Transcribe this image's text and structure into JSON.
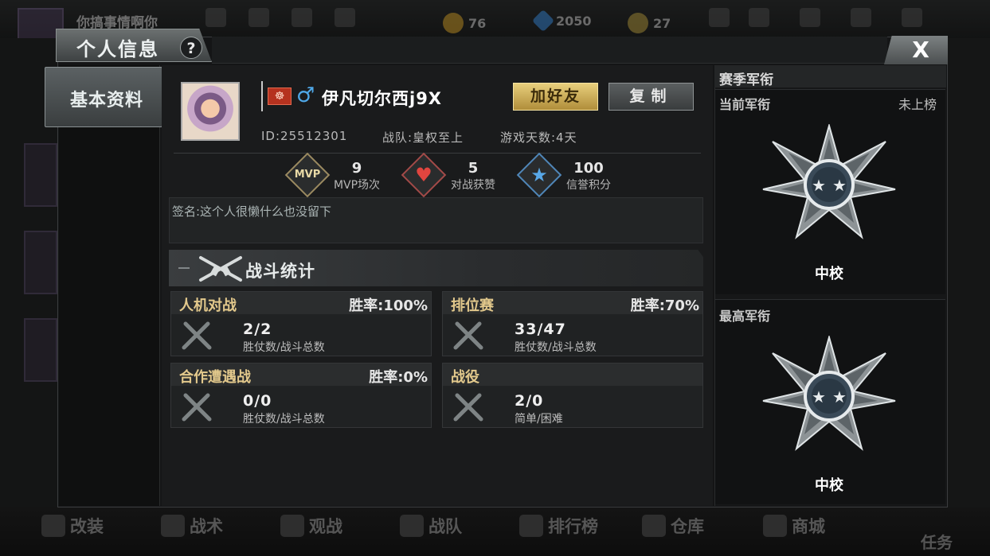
{
  "background": {
    "top_name": "你搞事情啊你",
    "currency": [
      {
        "icon": "gold-coin-icon",
        "value": "76",
        "color": "#c8962a"
      },
      {
        "icon": "diamond-icon",
        "value": "2050",
        "color": "#3a7fc8"
      },
      {
        "icon": "ticket-icon",
        "value": "27",
        "color": "#b8a040"
      }
    ],
    "bottom_nav": [
      "改装",
      "战术",
      "观战",
      "战队",
      "排行榜",
      "仓库",
      "商城"
    ],
    "task_label": "任务"
  },
  "dialog": {
    "title": "个人信息",
    "help_glyph": "?",
    "close_glyph": "X",
    "side_tab": "基本资料"
  },
  "profile": {
    "flag_glyph": "☸",
    "gender_glyph": "♂",
    "name": "伊凡切尔西j9X",
    "add_friend": "加好友",
    "copy": "复制",
    "id_text": "ID:25512301",
    "team_text": "战队:皇权至上",
    "days_text": "游戏天数:4天",
    "signature": "签名:这个人很懒什么也没留下"
  },
  "stats": [
    {
      "icon": "mvp-icon",
      "icon_glyph": "MVP",
      "value": "9",
      "label": "MVP场次"
    },
    {
      "icon": "heart-icon",
      "icon_glyph": "♥",
      "value": "5",
      "label": "对战获赞"
    },
    {
      "icon": "star-icon",
      "icon_glyph": "★",
      "value": "100",
      "label": "信誉积分"
    }
  ],
  "battle": {
    "section_title": "战斗统计",
    "cards": [
      {
        "name": "人机对战",
        "rate": "胜率:100%",
        "value": "2/2",
        "sub": "胜仗数/战斗总数"
      },
      {
        "name": "排位赛",
        "rate": "胜率:70%",
        "value": "33/47",
        "sub": "胜仗数/战斗总数"
      },
      {
        "name": "合作遭遇战",
        "rate": "胜率:0%",
        "value": "0/0",
        "sub": "胜仗数/战斗总数"
      },
      {
        "name": "战役",
        "rate": "",
        "value": "2/0",
        "sub": "简单/困难"
      }
    ]
  },
  "rank": {
    "header": "赛季军衔",
    "current_label": "当前军衔",
    "current_status": "未上榜",
    "current_rank": "中校",
    "highest_label": "最高军衔",
    "highest_rank": "中校"
  }
}
